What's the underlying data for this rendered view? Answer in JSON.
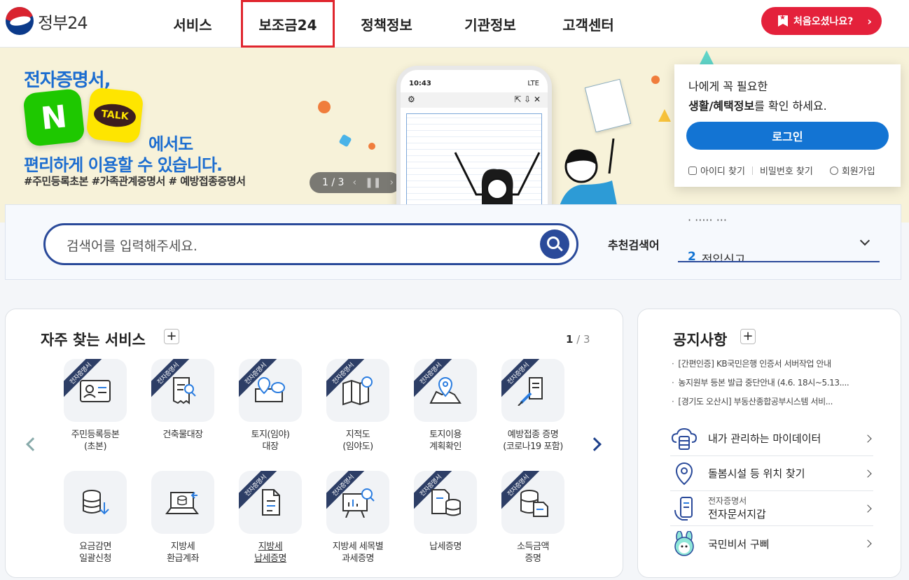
{
  "header": {
    "logo_text": "정부24",
    "nav": [
      "서비스",
      "보조금24",
      "정책정보",
      "기관정보",
      "고객센터"
    ],
    "first_visit": "처음오셨나요?"
  },
  "banner": {
    "title1": "전자증명서,",
    "naver": "N",
    "talk": "TALK",
    "title2": "에서도",
    "title3": "편리하게 이용할 수 있습니다.",
    "tags": "#주민등록초본  #가족관계증명서  # 예방접종증명서",
    "pager_current": "1",
    "pager_total": "3",
    "phone_time": "10:43",
    "phone_signal": "LTE"
  },
  "login": {
    "msg1": "나에게 꼭 필요한",
    "msg2_bold": "생활/혜택정보",
    "msg2_rest": "를 확인 하세요.",
    "button": "로그인",
    "find_id": "아이디 찾기",
    "find_pw": "비밀번호 찾기",
    "join": "회원가입"
  },
  "search": {
    "placeholder": "검색어를 입력해주세요.",
    "rec_label": "추천검색어",
    "rec_num": "2",
    "rec_term": "전입신고"
  },
  "services": {
    "title": "자주 찾는 서비스",
    "plus": "+",
    "page_current": "1",
    "page_total": "3",
    "ribbon": "전자증명서",
    "items": [
      {
        "label1": "주민등록등본",
        "label2": "(초본)",
        "ribbon": true
      },
      {
        "label1": "건축물대장",
        "label2": "",
        "ribbon": true
      },
      {
        "label1": "토지(임야)",
        "label2": "대장",
        "ribbon": true
      },
      {
        "label1": "지적도",
        "label2": "(임야도)",
        "ribbon": true
      },
      {
        "label1": "토지이용",
        "label2": "계획확인",
        "ribbon": true
      },
      {
        "label1": "예방접종 증명",
        "label2": "(코로나19 포함)",
        "ribbon": true
      },
      {
        "label1": "요금감면",
        "label2": "일괄신청",
        "ribbon": false
      },
      {
        "label1": "지방세",
        "label2": "환급계좌",
        "ribbon": false
      },
      {
        "label1": "지방세",
        "label2": "납세증명",
        "ribbon": true
      },
      {
        "label1": "지방세 세목별",
        "label2": "과세증명",
        "ribbon": true
      },
      {
        "label1": "납세증명",
        "label2": "",
        "ribbon": true
      },
      {
        "label1": "소득금액",
        "label2": "증명",
        "ribbon": true
      }
    ]
  },
  "notice": {
    "title": "공지사항",
    "plus": "+",
    "items": [
      "[간편인증] KB국민은행 인증서 서버작업 안내",
      "농지원부 등본 발급 중단안내 (4.6. 18시~5.13....",
      "[경기도 오산시] 부동산종합공부시스템 서비..."
    ],
    "quick": [
      {
        "sub": "",
        "label": "내가 관리하는 마이데이터"
      },
      {
        "sub": "",
        "label": "돌봄시설 등 위치 찾기"
      },
      {
        "sub": "전자증명서",
        "label": "전자문서지갑"
      },
      {
        "sub": "",
        "label": "국민비서 구삐"
      }
    ]
  },
  "colors": {
    "primary": "#1374d3",
    "navy": "#2a4a9a",
    "red": "#e4213b",
    "banner_bg": "#f7f2d9"
  }
}
